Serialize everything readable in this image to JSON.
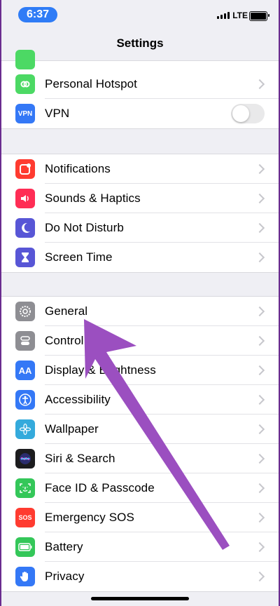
{
  "status_bar": {
    "time": "6:37",
    "network": "LTE"
  },
  "nav": {
    "title": "Settings"
  },
  "group1": {
    "items": [
      {
        "label": "Personal Hotspot",
        "icon": "hotspot-icon",
        "color": "#4cd964"
      },
      {
        "label": "VPN",
        "icon": "vpn-icon",
        "color": "#3478f6",
        "icon_text": "VPN",
        "toggle": false
      }
    ]
  },
  "group2": {
    "items": [
      {
        "label": "Notifications",
        "icon": "notifications-icon",
        "color": "#ff3b30"
      },
      {
        "label": "Sounds & Haptics",
        "icon": "speaker-icon",
        "color": "#ff2d55"
      },
      {
        "label": "Do Not Disturb",
        "icon": "moon-icon",
        "color": "#5856d6"
      },
      {
        "label": "Screen Time",
        "icon": "hourglass-icon",
        "color": "#5856d6"
      }
    ]
  },
  "group3": {
    "items": [
      {
        "label": "General",
        "icon": "gear-icon",
        "color": "#8e8e93"
      },
      {
        "label": "Control Centre",
        "icon": "control-centre-icon",
        "color": "#8e8e93"
      },
      {
        "label": "Display & Brightness",
        "icon": "display-icon",
        "color": "#3478f6",
        "icon_text": "AA"
      },
      {
        "label": "Accessibility",
        "icon": "accessibility-icon",
        "color": "#3478f6"
      },
      {
        "label": "Wallpaper",
        "icon": "wallpaper-icon",
        "color": "#34aadc"
      },
      {
        "label": "Siri & Search",
        "icon": "siri-icon",
        "color": "#1c1c1e"
      },
      {
        "label": "Face ID & Passcode",
        "icon": "face-id-icon",
        "color": "#34c759"
      },
      {
        "label": "Emergency SOS",
        "icon": "sos-icon",
        "color": "#ff3b30",
        "icon_text": "SOS"
      },
      {
        "label": "Battery",
        "icon": "battery-icon",
        "color": "#34c759"
      },
      {
        "label": "Privacy",
        "icon": "hand-icon",
        "color": "#3478f6"
      }
    ]
  },
  "annotation": {
    "arrow_color": "#9b4fc0"
  }
}
